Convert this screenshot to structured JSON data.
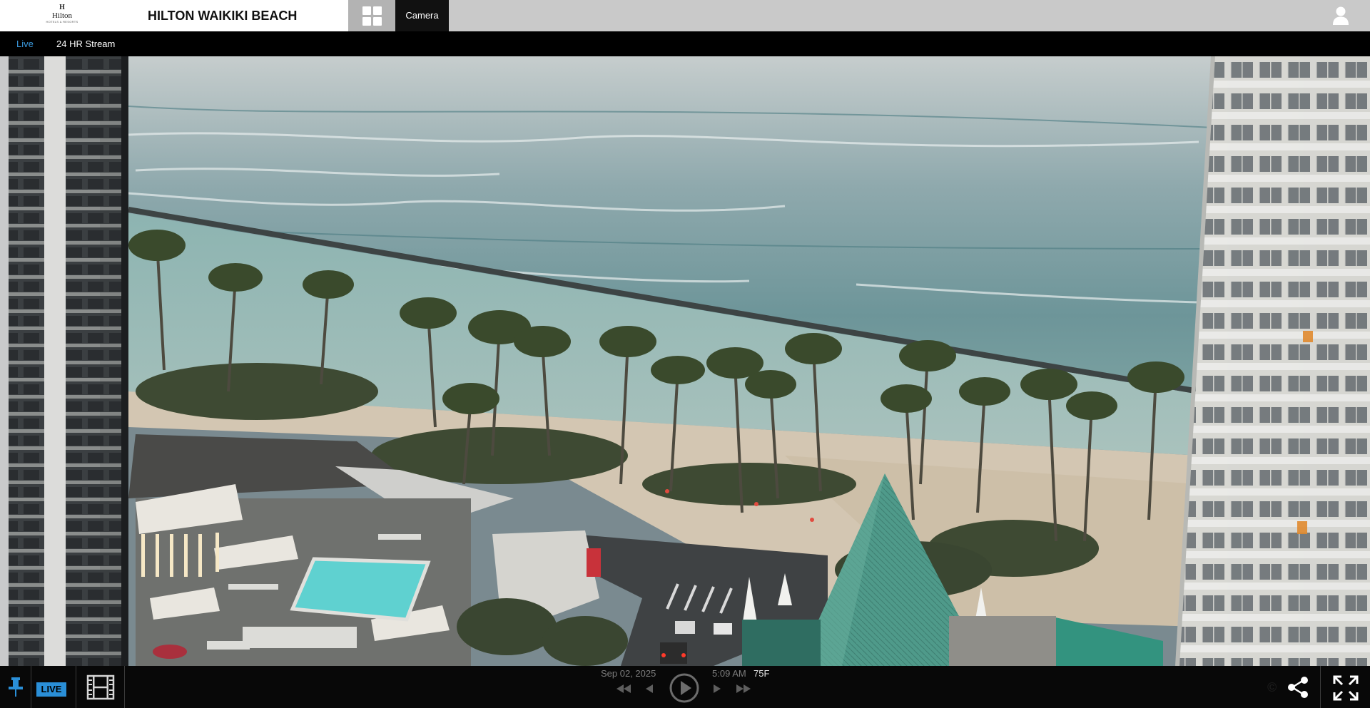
{
  "header": {
    "logo_mark": "H",
    "logo_word": "Hilton",
    "logo_tagline": "HOTELS & RESORTS",
    "site_title": "HILTON WAIKIKI BEACH",
    "camera_tab": "Camera"
  },
  "subnav": {
    "live_label": "Live",
    "stream_label": "24 HR Stream"
  },
  "controls": {
    "live_badge": "LIVE",
    "date": "Sep 02, 2025",
    "time": "5:09 AM",
    "temperature": "75F",
    "watermark": "©"
  },
  "icons": {
    "pin": "pin-icon",
    "film": "film-icon",
    "play": "play-icon",
    "share": "share-icon",
    "fullscreen": "fullscreen-icon",
    "user": "user-icon",
    "grid": "grid-icon"
  },
  "colors": {
    "accent_blue": "#2a8fd8",
    "live_text": "#3b9be0",
    "header_gray": "#c9c9c9",
    "grid_button": "#b3b3b3"
  }
}
